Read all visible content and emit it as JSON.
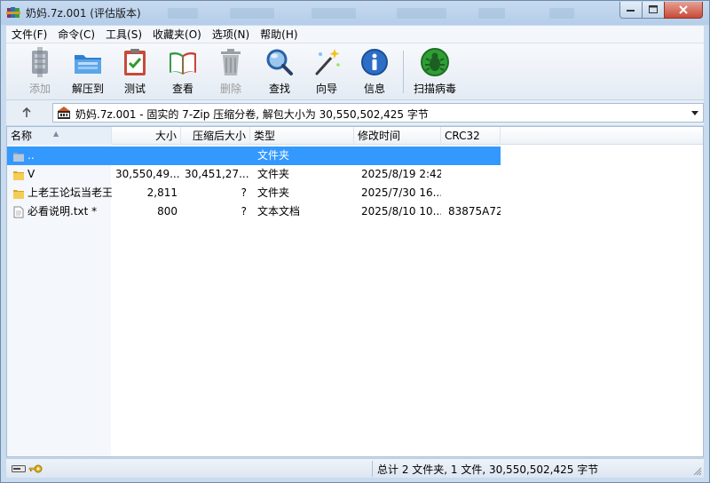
{
  "window": {
    "title": "奶妈.7z.001 (评估版本)"
  },
  "menu": [
    "文件(F)",
    "命令(C)",
    "工具(S)",
    "收藏夹(O)",
    "选项(N)",
    "帮助(H)"
  ],
  "toolbar": {
    "add": "添加",
    "extract": "解压到",
    "test": "测试",
    "view": "查看",
    "delete": "删除",
    "find": "查找",
    "wizard": "向导",
    "info": "信息",
    "virus": "扫描病毒"
  },
  "address": {
    "text": "奶妈.7z.001 - 固实的 7-Zip 压缩分卷, 解包大小为 30,550,502,425 字节"
  },
  "columns": {
    "name": "名称",
    "size": "大小",
    "packed": "压缩后大小",
    "type": "类型",
    "modified": "修改时间",
    "crc": "CRC32"
  },
  "rows": [
    {
      "name": "..",
      "size": "",
      "packed": "",
      "type": "文件夹",
      "modified": "",
      "crc": ""
    },
    {
      "name": "V",
      "size": "30,550,49...",
      "packed": "30,451,27...",
      "type": "文件夹",
      "modified": "2025/8/19 2:42",
      "crc": ""
    },
    {
      "name": "上老王论坛当老王",
      "size": "2,811",
      "packed": "?",
      "type": "文件夹",
      "modified": "2025/7/30 16...",
      "crc": ""
    },
    {
      "name": "必看说明.txt *",
      "size": "800",
      "packed": "?",
      "type": "文本文档",
      "modified": "2025/8/10 10...",
      "crc": "83875A72"
    }
  ],
  "status": {
    "summary": "总计 2 文件夹, 1 文件, 30,550,502,425 字节"
  },
  "icons": {
    "app": "winrar-books-icon",
    "up": "up-arrow-icon",
    "archive": "archive-001-icon",
    "folder": "folder-icon",
    "parent": "parent-folder-icon",
    "text_file": "text-file-icon"
  }
}
